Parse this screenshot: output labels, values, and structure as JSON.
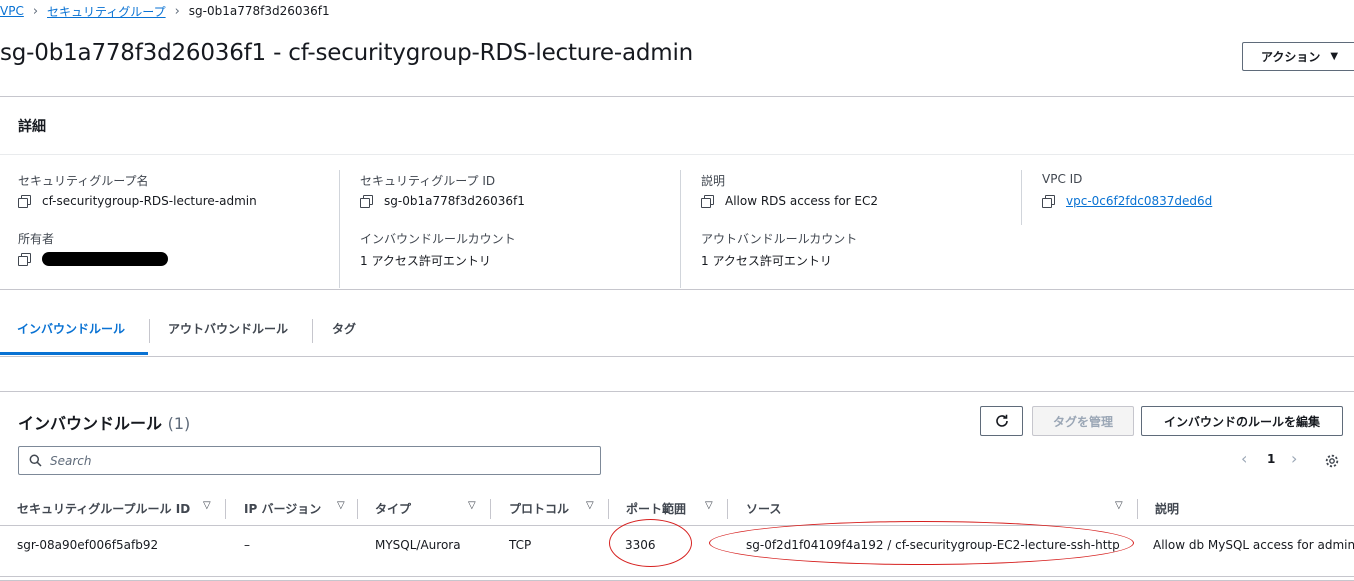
{
  "breadcrumb": {
    "vpc": "VPC",
    "security_groups": "セキュリティグループ",
    "current": "sg-0b1a778f3d26036f1"
  },
  "page": {
    "title": "sg-0b1a778f3d26036f1 - cf-securitygroup-RDS-lecture-admin",
    "actions_label": "アクション"
  },
  "details": {
    "title": "詳細",
    "fields": {
      "sg_name": {
        "label": "セキュリティグループ名",
        "value": "cf-securitygroup-RDS-lecture-admin"
      },
      "sg_id": {
        "label": "セキュリティグループ ID",
        "value": "sg-0b1a778f3d26036f1"
      },
      "description": {
        "label": "説明",
        "value": "Allow RDS access for EC2"
      },
      "vpc_id": {
        "label": "VPC ID",
        "value": "vpc-0c6f2fdc0837ded6d"
      },
      "owner": {
        "label": "所有者",
        "value": ""
      },
      "inbound_count": {
        "label": "インバウンドルールカウント",
        "value": "1 アクセス許可エントリ"
      },
      "outbound_count": {
        "label": "アウトバンドルールカウント",
        "value": "1 アクセス許可エントリ"
      }
    }
  },
  "tabs": [
    {
      "label": "インバウンドルール",
      "active": true
    },
    {
      "label": "アウトバウンドルール",
      "active": false
    },
    {
      "label": "タグ",
      "active": false
    }
  ],
  "rules": {
    "title": "インバウンドルール",
    "count": "(1)",
    "manage_tags_label": "タグを管理",
    "edit_rules_label": "インバウンドのルールを編集",
    "search_placeholder": "Search",
    "page_number": "1",
    "columns": {
      "rule_id": "セキュリティグループルール ID",
      "ip_version": "IP バージョン",
      "type": "タイプ",
      "protocol": "プロトコル",
      "port_range": "ポート範囲",
      "source": "ソース",
      "description": "説明"
    },
    "rows": [
      {
        "rule_id": "sgr-08a90ef006f5afb92",
        "ip_version": "–",
        "type": "MYSQL/Aurora",
        "protocol": "TCP",
        "port_range": "3306",
        "source": "sg-0f2d1f04109f4a192 / cf-securitygroup-EC2-lecture-ssh-http",
        "description": "Allow db MySQL access for admin"
      }
    ]
  },
  "colors": {
    "link": "#0972d3",
    "annotation": "#d6201f",
    "border": "#c6c6cd"
  },
  "icons": [
    "chevron-right-icon",
    "caret-down-icon",
    "copy-icon",
    "refresh-icon",
    "search-icon",
    "chevron-left-icon",
    "settings-icon",
    "sort-down-icon"
  ]
}
